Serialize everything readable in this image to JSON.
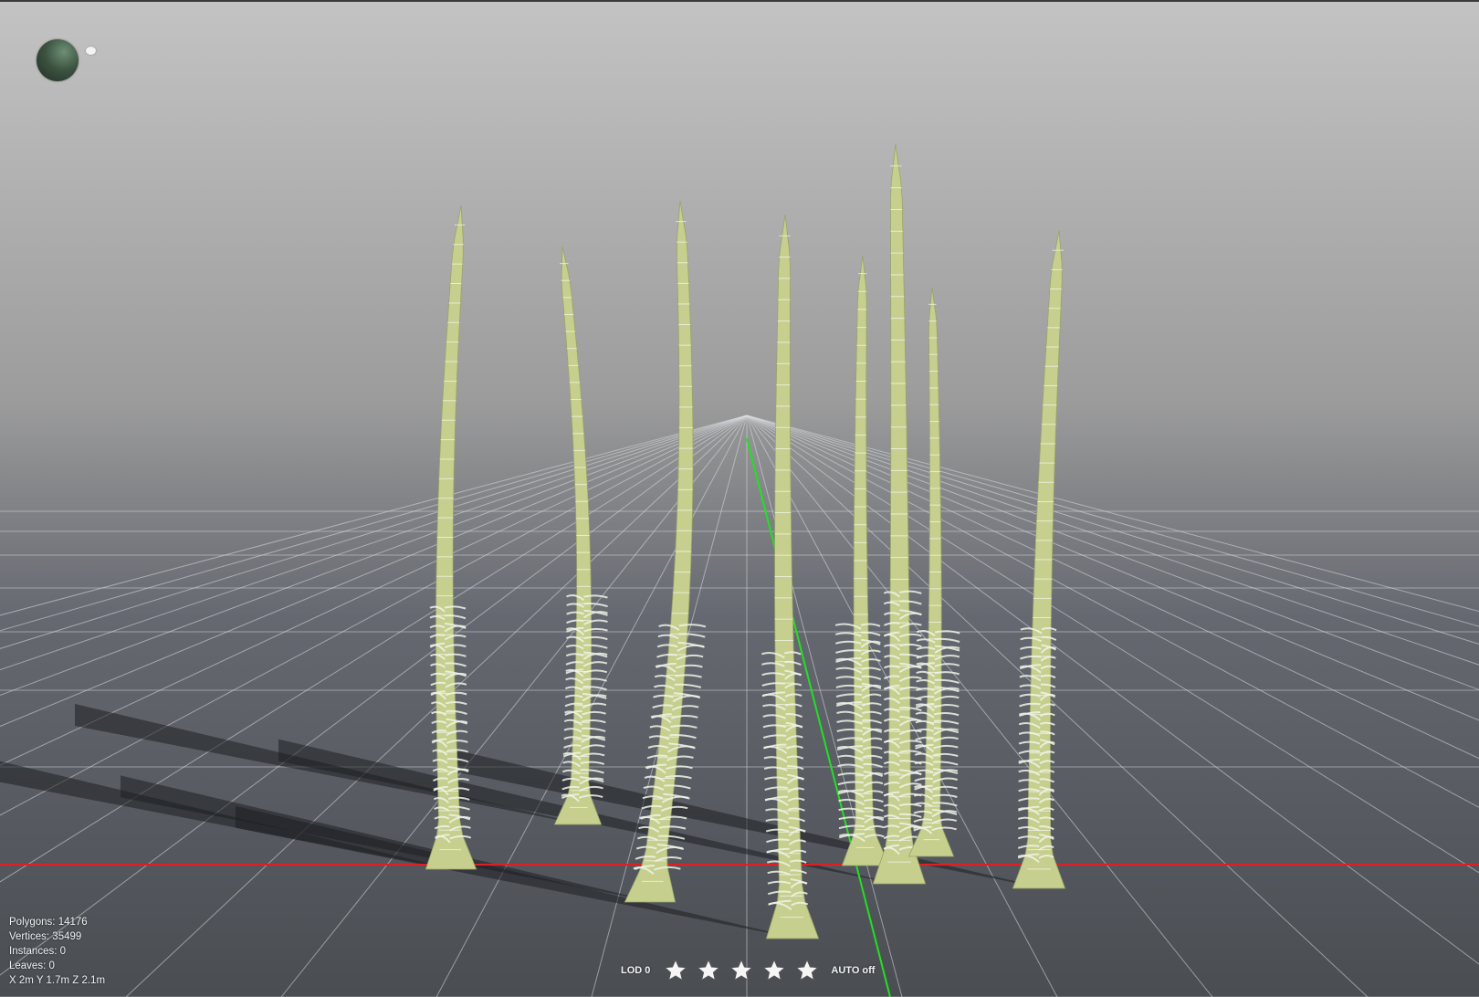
{
  "viewport": {
    "background_top": "#c3c3c3",
    "background_bottom": "#4a4d52",
    "grid_color": "#d9dce0",
    "x_axis_color": "#e02020",
    "y_axis_color": "#22e022",
    "stem_color": "#c6cf8e",
    "leaf_color": "#eef3e6"
  },
  "light_widget": {
    "sphere_icon": "light-direction-sphere-icon",
    "handle_icon": "light-handle-icon"
  },
  "stats": {
    "polygons": "Polygons: 14176",
    "vertices": "Vertices: 35499",
    "instances": "Instances: 0",
    "leaves": "Leaves: 0",
    "dimensions": "X 2m Y 1.7m Z 2.1m"
  },
  "lod_bar": {
    "label": "LOD 0",
    "stars": [
      "star-icon",
      "star-icon",
      "star-icon",
      "star-icon",
      "star-icon"
    ],
    "auto_label": "AUTO off"
  }
}
